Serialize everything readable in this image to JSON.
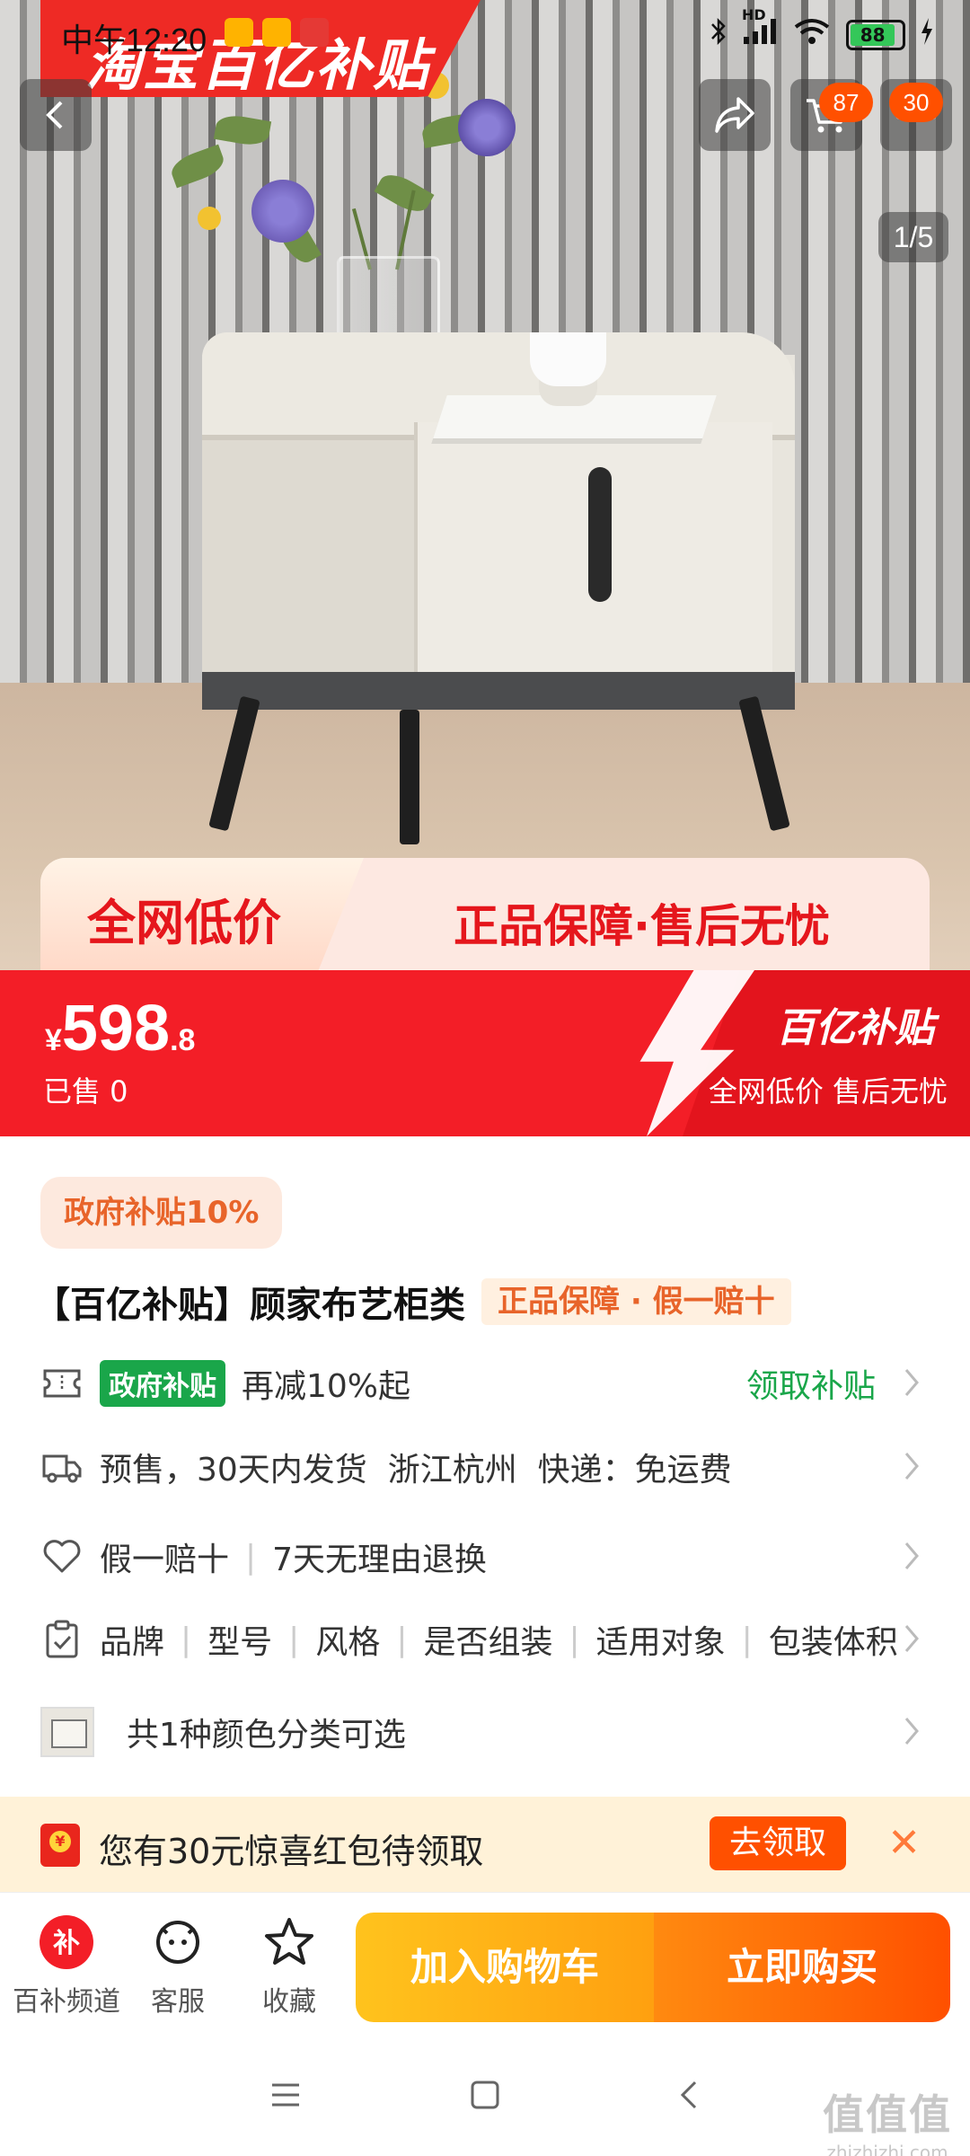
{
  "status_bar": {
    "time": "中午12:20",
    "battery": "88",
    "network": "HD"
  },
  "banner": {
    "logo": "淘宝百亿补贴"
  },
  "nav": {
    "cart_badge": "87",
    "more_badge": "30",
    "image_counter": "1/5"
  },
  "hero_promo": {
    "left": "全网低价",
    "right": "正品保障·售后无忧"
  },
  "price_band": {
    "currency": "¥",
    "price_int": "598",
    "price_dec": ".8",
    "sold": "已售 0",
    "logo": "百亿补贴",
    "slogan": "全网低价 售后无忧"
  },
  "product": {
    "gov_tag": "政府补贴10%",
    "title": "【百亿补贴】顾家布艺柜类",
    "guarantee": "正品保障 · 假一赔十"
  },
  "rows": {
    "subsidy_tag": "政府补贴",
    "subsidy_text": "再减10%起",
    "subsidy_link": "领取补贴",
    "shipping": "预售，30天内发货  浙江杭州  快递：免运费",
    "service_1": "假一赔十",
    "service_2": "7天无理由退换",
    "params": [
      "品牌",
      "型号",
      "风格",
      "是否组装",
      "适用对象",
      "包装体积"
    ],
    "variants": "共1种颜色分类可选"
  },
  "coupon": {
    "text": "您有30元惊喜红包待领取",
    "button": "去领取"
  },
  "action_bar": {
    "channel": "百补频道",
    "service": "客服",
    "favorite": "收藏",
    "add_cart": "加入购物车",
    "buy_now": "立即购买"
  },
  "watermark": {
    "big": "值值值",
    "small": "zhizhizhi.com"
  },
  "colors": {
    "brand_red": "#f31e27",
    "orange": "#ff5000",
    "green": "#1aa64a"
  }
}
